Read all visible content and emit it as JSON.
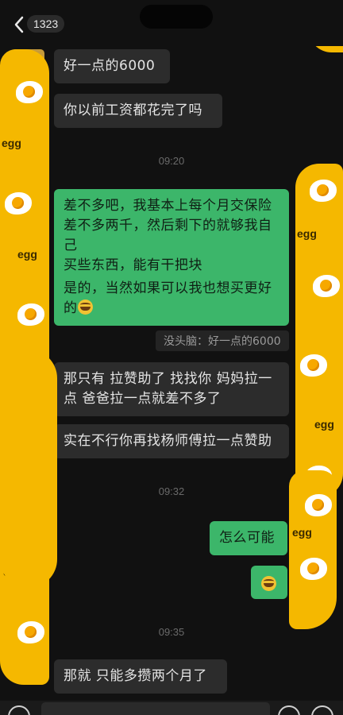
{
  "header": {
    "unread_count": "1323"
  },
  "messages": {
    "m1": "好一点的6000",
    "m2": "你以前工资都花完了吗",
    "t1": "09:20",
    "m3_l1": "差不多吧，我基本上每个月交保险",
    "m3_l2": "差不多两千，然后剩下的就够我自己",
    "m3_l3": "买些东西，能有干把块",
    "m4_l1": "是的，当然如果可以我也想买更好",
    "m4_l2": "的",
    "quote": "没头脑：好一点的6000",
    "m5_l1": "那只有 拉赞助了 找找你 妈妈拉一",
    "m5_l2": "点 爸爸拉一点就差不多了",
    "m6": "实在不行你再找杨师傅拉一点赞助",
    "t2": "09:32",
    "m7": "怎么可能",
    "t3": "09:35",
    "m9": "那就 只能多攒两个月了"
  },
  "icons": {
    "back": "chevron-left-icon",
    "emoji": "laughing-face-emoji"
  },
  "scribble_text": "egg",
  "colors": {
    "incoming": "#2c2c2c",
    "outgoing": "#3cb66a",
    "scribble": "#f5b800"
  }
}
